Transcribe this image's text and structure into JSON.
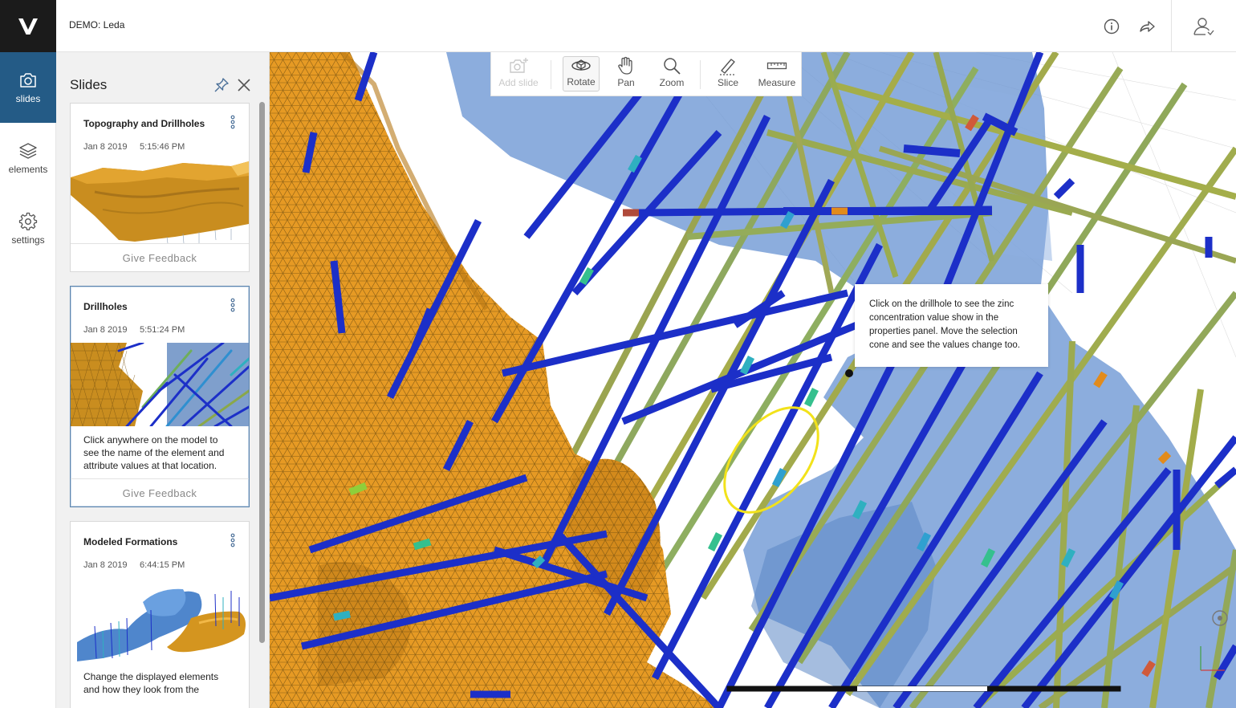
{
  "app": {
    "logo_letter": "V",
    "project_title": "DEMO: Leda"
  },
  "topbar": {
    "icons": [
      "info-icon",
      "share-icon",
      "user-icon"
    ]
  },
  "nav": {
    "items": [
      {
        "label": "slides",
        "icon": "camera-icon",
        "active": true
      },
      {
        "label": "elements",
        "icon": "layers-icon",
        "active": false
      },
      {
        "label": "settings",
        "icon": "gear-icon",
        "active": false
      }
    ]
  },
  "slides_panel": {
    "title": "Slides",
    "cards": [
      {
        "title": "Topography and Drillholes",
        "date": "Jan 8 2019",
        "time": "5:15:46 PM",
        "description": "",
        "feedback_label": "Give Feedback",
        "selected": false
      },
      {
        "title": "Drillholes",
        "date": "Jan 8 2019",
        "time": "5:51:24 PM",
        "description": "Click anywhere on the model to see the name of the element and attribute values at that location.",
        "feedback_label": "Give Feedback",
        "selected": true
      },
      {
        "title": "Modeled Formations",
        "date": "Jan 8 2019",
        "time": "6:44:15 PM",
        "description": "Change the displayed elements and how they look from the",
        "feedback_label": "",
        "selected": false
      }
    ]
  },
  "toolbar": {
    "tools": [
      {
        "label": "Add slide",
        "icon": "add-slide-icon",
        "state": "disabled"
      },
      {
        "label": "Rotate",
        "icon": "rotate-icon",
        "state": "active"
      },
      {
        "label": "Pan",
        "icon": "hand-icon",
        "state": "normal"
      },
      {
        "label": "Zoom",
        "icon": "magnifier-icon",
        "state": "normal"
      },
      {
        "label": "Slice",
        "icon": "slice-icon",
        "state": "normal"
      },
      {
        "label": "Measure",
        "icon": "ruler-icon",
        "state": "normal"
      }
    ]
  },
  "tooltip": {
    "text": "Click on the drillhole to see the zinc concentration value show in the properties panel. Move the selection cone and see the values change too."
  },
  "colors": {
    "nav_active": "#245b86",
    "formation_orange": "#e69a24",
    "formation_blue": "#5f8fd0",
    "drillhole_blue": "#1c2fc8",
    "selection_ring": "#f2e21a"
  }
}
